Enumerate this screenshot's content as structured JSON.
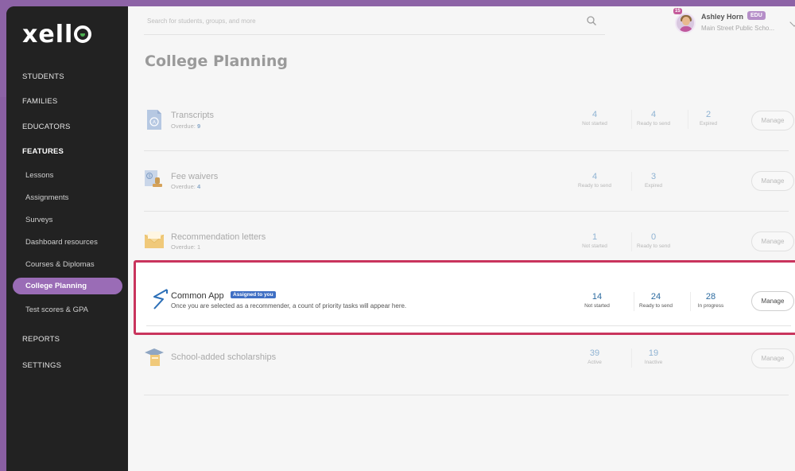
{
  "app": {
    "logo": "xello"
  },
  "sidebar": {
    "items": [
      {
        "label": "STUDENTS"
      },
      {
        "label": "FAMILIES"
      },
      {
        "label": "EDUCATORS"
      },
      {
        "label": "FEATURES"
      },
      {
        "label": "REPORTS"
      },
      {
        "label": "SETTINGS"
      }
    ],
    "features": [
      {
        "label": "Lessons"
      },
      {
        "label": "Assignments"
      },
      {
        "label": "Surveys"
      },
      {
        "label": "Dashboard resources"
      },
      {
        "label": "Courses & Diplomas"
      },
      {
        "label": "College Planning"
      },
      {
        "label": "Test scores & GPA"
      }
    ],
    "active": "College Planning"
  },
  "header": {
    "search_placeholder": "Search for students, groups, and more",
    "user": {
      "name": "Ashley Horn",
      "role_badge": "EDU",
      "school": "Main Street Public Scho...",
      "notification_count": "15"
    }
  },
  "page": {
    "title": "College Planning"
  },
  "rows": [
    {
      "name": "Transcripts",
      "overdue_label": "Overdue:",
      "overdue_count": "9",
      "stats": [
        {
          "value": "4",
          "label": "Not started"
        },
        {
          "value": "4",
          "label": "Ready to send"
        },
        {
          "value": "2",
          "label": "Expired"
        }
      ],
      "manage": "Manage",
      "icon": "transcript-document-icon"
    },
    {
      "name": "Fee waivers",
      "overdue_label": "Overdue:",
      "overdue_count": "4",
      "stats": [
        {
          "value": "4",
          "label": "Ready to send"
        },
        {
          "value": "3",
          "label": "Expired"
        }
      ],
      "manage": "Manage",
      "icon": "fee-waiver-stamp-icon"
    },
    {
      "name": "Recommendation letters",
      "overdue_label": "Overdue:",
      "overdue_count": "1",
      "stats": [
        {
          "value": "1",
          "label": "Not started"
        },
        {
          "value": "0",
          "label": "Ready to send"
        }
      ],
      "manage": "Manage",
      "icon": "envelope-icon"
    },
    {
      "name": "Common App",
      "badge": "Assigned to you",
      "description": "Once you are selected as a recommender, a count of priority tasks will appear here.",
      "stats": [
        {
          "value": "14",
          "label": "Not started"
        },
        {
          "value": "24",
          "label": "Ready to send"
        },
        {
          "value": "28",
          "label": "In progress"
        }
      ],
      "manage": "Manage",
      "icon": "common-app-logo-icon"
    },
    {
      "name": "School-added scholarships",
      "stats": [
        {
          "value": "39",
          "label": "Active"
        },
        {
          "value": "19",
          "label": "Inactive"
        }
      ],
      "manage": "Manage",
      "icon": "graduation-cap-icon"
    }
  ],
  "colors": {
    "brand_purple": "#8d63a6",
    "active_nav": "#9a6cb6",
    "highlight_border": "#c9345d",
    "badge_blue": "#3f6fc4",
    "stat_blue": "#2b6a9f"
  }
}
